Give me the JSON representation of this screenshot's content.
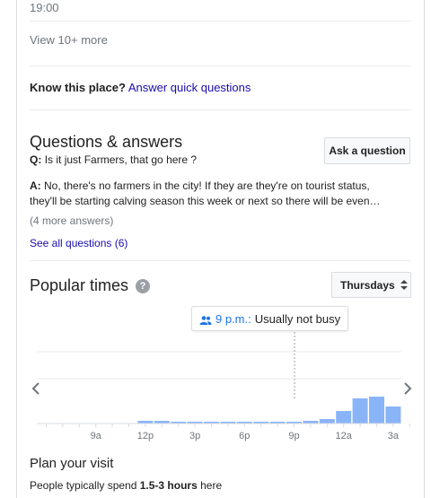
{
  "top": {
    "time": "19:00",
    "view_more": "View 10+ more"
  },
  "know": {
    "label": "Know this place?",
    "link": "Answer quick questions"
  },
  "qa": {
    "title": "Questions & answers",
    "ask_button": "Ask a question",
    "q_prefix": "Q:",
    "question": "Is it just Farmers, that go here ?",
    "a_prefix": "A:",
    "answer_line1": "No, there's no farmers in the city! If they are they're on tourist status,",
    "answer_line2": "they'll be starting calving season this week or next so there will be even…",
    "more_answers": "(4 more answers)",
    "see_all": "See all questions (6)"
  },
  "popular": {
    "title": "Popular times",
    "help_icon": "?",
    "day_select": "Thursdays",
    "tooltip_time": "9 p.m.:",
    "tooltip_status": "Usually not busy"
  },
  "chart_data": {
    "type": "bar",
    "categories": [
      "6a",
      "7a",
      "8a",
      "9a",
      "10a",
      "11a",
      "12p",
      "1p",
      "2p",
      "3p",
      "4p",
      "5p",
      "6p",
      "7p",
      "8p",
      "9p",
      "10p",
      "11p",
      "12a",
      "1a",
      "2a",
      "3a",
      "4a"
    ],
    "values": [
      0,
      0,
      0,
      0,
      0,
      0,
      3,
      3,
      2,
      2,
      2,
      2,
      2,
      2,
      2,
      2,
      3,
      5,
      14,
      28,
      30,
      19,
      0
    ],
    "x_tick_labels": [
      "9a",
      "12p",
      "3p",
      "6p",
      "9p",
      "12a",
      "3a"
    ],
    "highlight_category": "9p",
    "ylim": [
      0,
      100
    ],
    "grid": true
  },
  "plan": {
    "title": "Plan your visit",
    "text_pre": "People typically spend ",
    "text_bold": "1.5-3 hours",
    "text_post": " here"
  },
  "colors": {
    "bar": "#8ab4f8",
    "link": "#1a0dab",
    "accent": "#1a73e8"
  }
}
